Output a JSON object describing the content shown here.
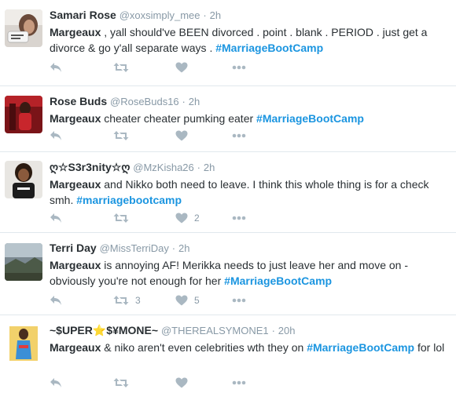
{
  "colors": {
    "hashtag": "#1b95e0",
    "icon": "#aab8c2",
    "meta": "#8899a6",
    "divider": "#e1e8ed"
  },
  "tweets": [
    {
      "name": "Samari Rose",
      "handle": "@xoxsimply_mee",
      "sep": "·",
      "time": "2h",
      "text_before": "Margeaux",
      "text_mid": " , yall should've BEEN divorced . point . blank . PERIOD . just get a divorce & go y'all separate ways . ",
      "hashtag": "#MarriageBootCamp",
      "text_after": "",
      "retweets": "",
      "likes": "",
      "avatar_icon": "avatar-photo"
    },
    {
      "name": "Rose Buds",
      "handle": "@RoseBuds16",
      "sep": "·",
      "time": "2h",
      "text_before": "Margeaux",
      "text_mid": " cheater cheater pumking eater ",
      "hashtag": "#MarriageBootCamp",
      "text_after": "",
      "retweets": "",
      "likes": "",
      "avatar_icon": "avatar-photo"
    },
    {
      "name": "ღ☆S3r3nity☆ღ",
      "handle": "@MzKisha26",
      "sep": "·",
      "time": "2h",
      "text_before": "Margeaux",
      "text_mid": " and Nikko both need to leave. I think this whole thing is for a check smh. ",
      "hashtag": "#marriagebootcamp",
      "text_after": "",
      "retweets": "",
      "likes": "2",
      "avatar_icon": "avatar-photo"
    },
    {
      "name": "Terri Day",
      "handle": "@MissTerriDay",
      "sep": "·",
      "time": "2h",
      "text_before": "Margeaux",
      "text_mid": " is annoying AF! Merikka needs to just leave her and move on - obviously you're not enough for her ",
      "hashtag": "#MarriageBootCamp",
      "text_after": "",
      "retweets": "3",
      "likes": "5",
      "avatar_icon": "avatar-photo"
    },
    {
      "name": "~$UPER⭐$¥MONE~",
      "handle": "@THEREALSYMONE1",
      "sep": "·",
      "time": "20h",
      "text_before": "Margeaux",
      "text_mid": " & niko aren't even celebrities wth they on ",
      "hashtag": "#MarriageBootCamp",
      "text_after": " for lol",
      "retweets": "",
      "likes": "",
      "avatar_icon": "avatar-photo"
    }
  ]
}
